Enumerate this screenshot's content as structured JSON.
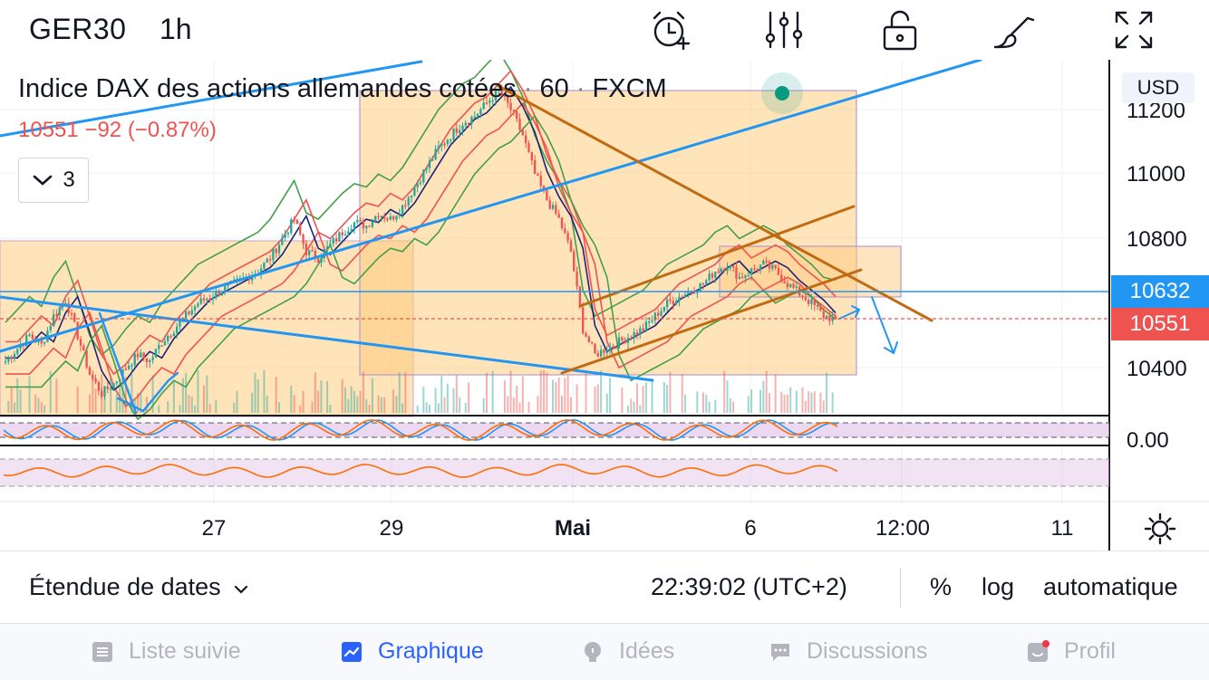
{
  "header": {
    "symbol": "GER30",
    "interval": "1h",
    "icons": [
      "alarm-add-icon",
      "indicators-icon",
      "unlock-icon",
      "drawing-brush-icon",
      "fullscreen-icon"
    ]
  },
  "legend": {
    "title": "Indice DAX des actions allemandes cotées",
    "resolution": "60",
    "exchange": "FXCM",
    "last": "10551",
    "change": "−92",
    "change_pct": "(−0.87%)",
    "collapsed_count": "3"
  },
  "price_axis": {
    "currency": "USD",
    "ticks": [
      "11200",
      "11000",
      "10800",
      "10400",
      "0.00"
    ],
    "last_price_label": "10551",
    "line_price_label": "10632"
  },
  "time_axis": {
    "ticks": [
      "27",
      "29",
      "Mai",
      "6",
      "12:00",
      "11"
    ]
  },
  "controls": {
    "date_range": "Étendue de dates",
    "clock": "22:39:02 (UTC+2)",
    "percent": "%",
    "log": "log",
    "auto": "automatique"
  },
  "tabs": [
    {
      "label": "Liste suivie",
      "icon": "watchlist-icon",
      "active": false
    },
    {
      "label": "Graphique",
      "icon": "chart-icon",
      "active": true
    },
    {
      "label": "Idées",
      "icon": "ideas-icon",
      "active": false
    },
    {
      "label": "Discussions",
      "icon": "chat-icon",
      "active": false
    },
    {
      "label": "Profil",
      "icon": "profile-icon",
      "active": false
    }
  ],
  "colors": {
    "up": "#26a69a",
    "down": "#ef5350",
    "accent": "#2962ff",
    "trendline": "#2196f3",
    "channel": "#c06a12",
    "zone": "#ffcc80"
  },
  "chart_data": {
    "type": "candlestick",
    "symbol": "GER30",
    "interval": "60",
    "y_range": [
      10300,
      11300
    ],
    "y_ticks": [
      10400,
      10800,
      11000,
      11200
    ],
    "x_labels": [
      "27",
      "29",
      "Mai",
      "6",
      "12:00",
      "11"
    ],
    "close_path": [
      10420,
      10460,
      10500,
      10470,
      10560,
      10610,
      10500,
      10380,
      10320,
      10350,
      10400,
      10440,
      10420,
      10480,
      10520,
      10560,
      10600,
      10620,
      10640,
      10660,
      10680,
      10700,
      10740,
      10800,
      10860,
      10760,
      10740,
      10780,
      10820,
      10850,
      10840,
      10880,
      10860,
      10900,
      10960,
      11020,
      11080,
      11120,
      11160,
      11180,
      11220,
      11260,
      11200,
      11120,
      11000,
      10920,
      10860,
      10760,
      10520,
      10440,
      10460,
      10480,
      10500,
      10520,
      10560,
      10600,
      10620,
      10640,
      10660,
      10700,
      10720,
      10680,
      10700,
      10720,
      10700,
      10660,
      10630,
      10600,
      10560,
      10551
    ],
    "last_price": 10551,
    "horizontal_line": 10632
  }
}
